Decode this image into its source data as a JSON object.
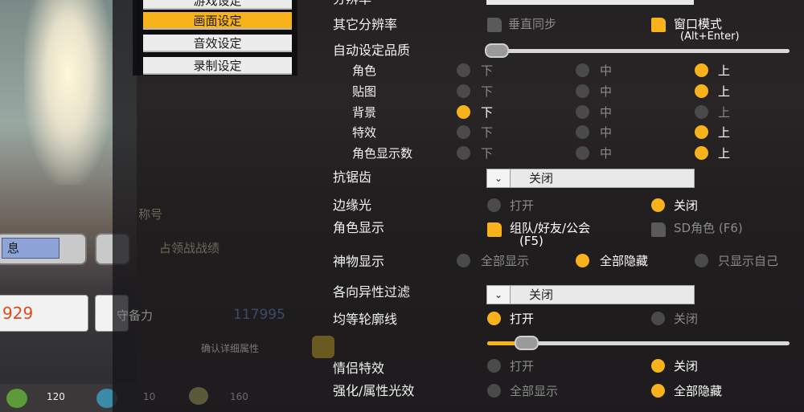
{
  "menu": {
    "items": [
      {
        "label": "游戏设定"
      },
      {
        "label": "画面设定"
      },
      {
        "label": "音效设定"
      },
      {
        "label": "录制设定"
      }
    ]
  },
  "settings": {
    "top_label": "分辨率",
    "other_res": {
      "label": "其它分辨率",
      "vsync": "垂直同步",
      "window_mode": "窗口模式",
      "window_mode_hint": "(Alt+Enter)"
    },
    "auto_quality": {
      "label": "自动设定品质"
    },
    "quality_rows": [
      {
        "label": "角色"
      },
      {
        "label": "贴图"
      },
      {
        "label": "背景"
      },
      {
        "label": "特效"
      },
      {
        "label": "角色显示数"
      }
    ],
    "quality_levels": [
      "下",
      "中",
      "上"
    ],
    "anti_alias": {
      "label": "抗锯齿",
      "value": "关闭"
    },
    "edge_light": {
      "label": "边缘光",
      "on": "打开",
      "off": "关闭"
    },
    "char_display": {
      "label": "角色显示",
      "opt1": "组队/好友/公会",
      "opt1_hint": "(F5)",
      "opt2": "SD角色 (F6)"
    },
    "artifact_display": {
      "label": "神物显示",
      "show_all": "全部显示",
      "hide_all": "全部隐藏",
      "self_only": "只显示自己"
    },
    "aniso": {
      "label": "各向异性过滤",
      "value": "关闭"
    },
    "contour": {
      "label": "均等轮廓线",
      "on": "打开",
      "off": "关闭",
      "level": 0.1
    },
    "couple_fx": {
      "label": "情侣特效",
      "on": "打开",
      "off": "关闭"
    },
    "enhance_fx": {
      "label": "强化/属性光效",
      "show_all": "全部显示",
      "hide_all": "全部隐藏"
    }
  },
  "hud": {
    "value_929": "929",
    "def_label": "守备力",
    "def_value": "117995",
    "detail_label": "确认详细属性",
    "count1": "120",
    "count2": "10",
    "count3": "160",
    "info_tab": "息",
    "title_label": "称号",
    "battle_label": "占领战战绩"
  },
  "colors": {
    "accent": "#f8b21b",
    "panel_bg": "#161518",
    "text": "#f2f2f2",
    "disabled": "#8a8a8a"
  }
}
